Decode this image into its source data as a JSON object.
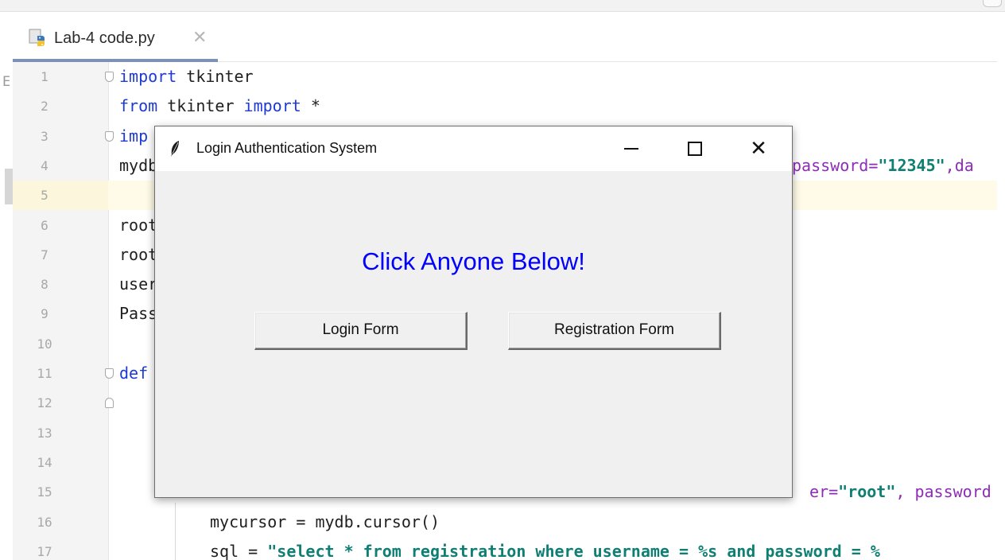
{
  "ide": {
    "tab": {
      "filename": "Lab-4 code.py",
      "close_glyph": "✕"
    },
    "left_glyph": "E",
    "lines": [
      {
        "n": "1",
        "tokens": [
          {
            "t": "import",
            "c": "kw"
          },
          {
            "t": " tkinter",
            "c": ""
          }
        ]
      },
      {
        "n": "2",
        "tokens": [
          {
            "t": "from",
            "c": "kw"
          },
          {
            "t": " tkinter ",
            "c": ""
          },
          {
            "t": "import",
            "c": "kw"
          },
          {
            "t": " *",
            "c": ""
          }
        ]
      },
      {
        "n": "3",
        "tokens": [
          {
            "t": "imp",
            "c": "kw"
          }
        ]
      },
      {
        "n": "4",
        "tokens": [
          {
            "t": "mydb",
            "c": ""
          }
        ],
        "right_tokens": [
          {
            "t": "password=",
            "c": "param"
          },
          {
            "t": "\"12345\"",
            "c": "str"
          },
          {
            "t": ",da",
            "c": "param"
          }
        ]
      },
      {
        "n": "5",
        "tokens": []
      },
      {
        "n": "6",
        "tokens": [
          {
            "t": "root",
            "c": ""
          }
        ]
      },
      {
        "n": "7",
        "tokens": [
          {
            "t": "root",
            "c": ""
          }
        ]
      },
      {
        "n": "8",
        "tokens": [
          {
            "t": "user",
            "c": ""
          }
        ]
      },
      {
        "n": "9",
        "tokens": [
          {
            "t": "Pass",
            "c": ""
          }
        ]
      },
      {
        "n": "10",
        "tokens": []
      },
      {
        "n": "11",
        "tokens": [
          {
            "t": "def",
            "c": "kw"
          }
        ]
      },
      {
        "n": "12",
        "tokens": []
      },
      {
        "n": "13",
        "tokens": []
      },
      {
        "n": "14",
        "tokens": []
      },
      {
        "n": "15",
        "tokens": [],
        "right_tokens": [
          {
            "t": "er=",
            "c": "param"
          },
          {
            "t": "\"root\"",
            "c": "str"
          },
          {
            "t": ", password",
            "c": "param"
          }
        ]
      },
      {
        "n": "16",
        "tokens": [
          {
            "t": "mycursor = mydb.cursor()",
            "c": ""
          }
        ],
        "indent": true
      },
      {
        "n": "17",
        "tokens": [
          {
            "t": "sql = ",
            "c": ""
          },
          {
            "t": "\"select * from registration where username = %s and password = %",
            "c": "str"
          }
        ],
        "indent": true
      }
    ]
  },
  "dialog": {
    "title": "Login Authentication System",
    "heading": "Click Anyone Below!",
    "buttons": {
      "login": "Login Form",
      "register": "Registration Form"
    },
    "close_glyph": "✕"
  },
  "colors": {
    "keyword": "#1d39d6",
    "string": "#0f7f73",
    "param": "#8d2db6",
    "heading": "#0000ff"
  }
}
